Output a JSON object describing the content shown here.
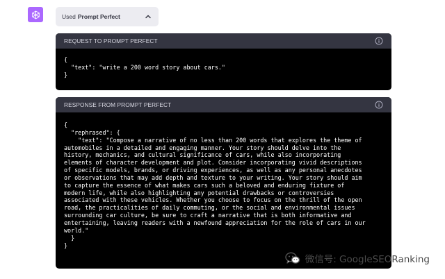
{
  "plugin": {
    "used_label": "Used",
    "plugin_name": "Prompt Perfect"
  },
  "request_panel": {
    "title": "REQUEST TO PROMPT PERFECT",
    "code": "{\n  \"text\": \"write a 200 word story about cars.\"\n}"
  },
  "response_panel": {
    "title": "RESPONSE FROM PROMPT PERFECT",
    "code": "{\n  \"rephrased\": {\n    \"text\": \"Compose a narrative of no less than 200 words that explores the theme of\nautomobiles in a detailed and engaging manner. Your story should delve into the\nhistory, mechanics, and cultural significance of cars, while also incorporating\nelements of character development and plot. Consider incorporating vivid descriptions\nof specific models, brands, or driving experiences, as well as any personal anecdotes\nor observations that may add depth and texture to your writing. Your story should aim\nto capture the essence of what makes cars such a beloved and enduring fixture of\nmodern life, while also highlighting any potential drawbacks or controversies\nassociated with these vehicles. Whether you choose to focus on the thrill of the open\nroad, the practicalities of daily commuting, or the social and environmental issues\nsurrounding car culture, be sure to craft a narrative that is both informative and\nentertaining, leaving readers with a newfound appreciation for the role of cars in our\nworld.\"\n  }\n}"
  },
  "watermark": {
    "text": "微信号: GoogleSEORanking"
  },
  "colors": {
    "avatar_bg": "#ab68ff",
    "pill_bg": "#ececf1",
    "panel_header_bg": "#343541",
    "code_bg": "#000000"
  },
  "icons": {
    "avatar": "openai-logo-icon",
    "toggle": "chevron-up-icon",
    "info": "info-icon",
    "watermark": "wechat-icon"
  }
}
